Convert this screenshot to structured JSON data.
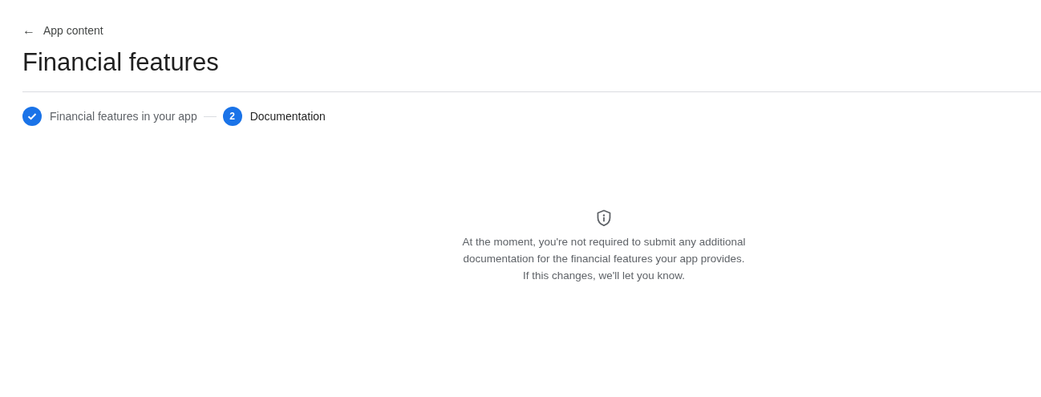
{
  "back_link": {
    "label": "App content",
    "icon": "←"
  },
  "title": "Financial features",
  "steps": [
    {
      "label": "Financial features in your app",
      "completed": true,
      "selected": false
    },
    {
      "label": "Documentation",
      "number": "2",
      "completed": false,
      "selected": true
    }
  ],
  "message": "At the moment, you're not required to submit any additional documentation for the financial features your app provides. If this changes, we'll let you know."
}
